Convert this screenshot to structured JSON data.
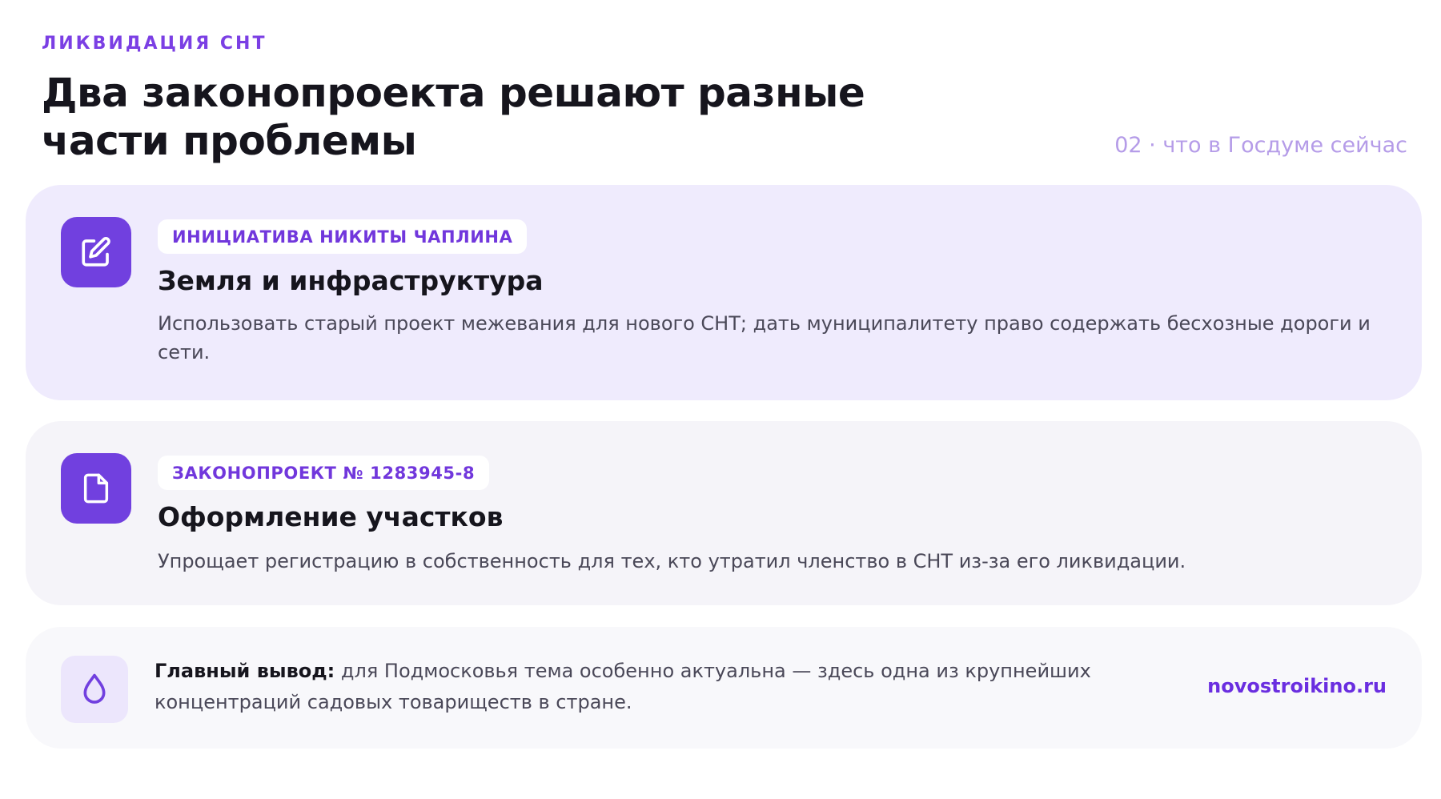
{
  "header": {
    "eyebrow": "ЛИКВИДАЦИЯ СНТ",
    "title": "Два законопроекта решают разные части проблемы",
    "section_tag": "02 · что в Госдуме сейчас"
  },
  "cards": [
    {
      "icon": "edit-icon",
      "tag": "ИНИЦИАТИВА НИКИТЫ ЧАПЛИНА",
      "title": "Земля и инфраструктура",
      "text": "Использовать старый проект межевания для нового СНТ; дать муниципалитету право содержать бесхозные дороги и сети."
    },
    {
      "icon": "document-icon",
      "tag": "ЗАКОНОПРОЕКТ № 1283945-8",
      "title": "Оформление участков",
      "text": "Упрощает регистрацию в собственность для тех, кто утратил членство в СНТ из-за его ликвидации."
    }
  ],
  "summary": {
    "icon": "drop-icon",
    "lead": "Главный вывод:",
    "text": " для Подмосковья тема особенно актуальна — здесь одна из крупнейших концентраций садовых товариществ в стране.",
    "link": "novostroikino.ru"
  },
  "colors": {
    "accent": "#7140df",
    "eyebrow": "#7b3fe4",
    "section_tag": "#b59ce8",
    "primary_card_bg": "#efebfd",
    "secondary_card_bg": "#f5f4f9",
    "summary_card_bg": "#f8f8fb"
  }
}
